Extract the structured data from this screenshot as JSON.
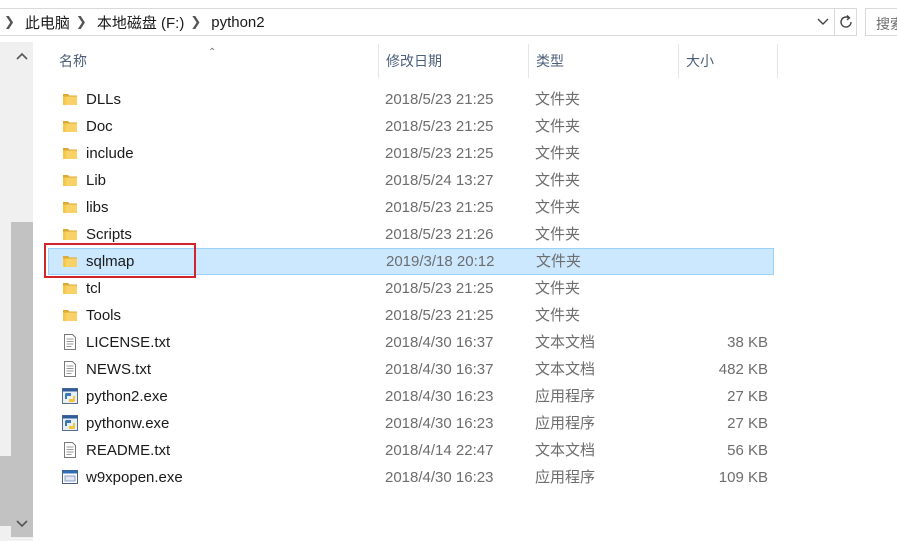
{
  "address": {
    "breadcrumbs": [
      "此电脑",
      "本地磁盘 (F:)",
      "python2"
    ]
  },
  "search": {
    "placeholder": "搜索"
  },
  "columns": {
    "name": "名称",
    "date": "修改日期",
    "type": "类型",
    "size": "大小"
  },
  "files": [
    {
      "name": "DLLs",
      "date": "2018/5/23 21:25",
      "type": "文件夹",
      "size": "",
      "icon": "folder-icon"
    },
    {
      "name": "Doc",
      "date": "2018/5/23 21:25",
      "type": "文件夹",
      "size": "",
      "icon": "folder-icon"
    },
    {
      "name": "include",
      "date": "2018/5/23 21:25",
      "type": "文件夹",
      "size": "",
      "icon": "folder-icon"
    },
    {
      "name": "Lib",
      "date": "2018/5/24 13:27",
      "type": "文件夹",
      "size": "",
      "icon": "folder-icon"
    },
    {
      "name": "libs",
      "date": "2018/5/23 21:25",
      "type": "文件夹",
      "size": "",
      "icon": "folder-icon"
    },
    {
      "name": "Scripts",
      "date": "2018/5/23 21:26",
      "type": "文件夹",
      "size": "",
      "icon": "folder-icon"
    },
    {
      "name": "sqlmap",
      "date": "2019/3/18 20:12",
      "type": "文件夹",
      "size": "",
      "icon": "folder-icon",
      "selected": true
    },
    {
      "name": "tcl",
      "date": "2018/5/23 21:25",
      "type": "文件夹",
      "size": "",
      "icon": "folder-icon"
    },
    {
      "name": "Tools",
      "date": "2018/5/23 21:25",
      "type": "文件夹",
      "size": "",
      "icon": "folder-icon"
    },
    {
      "name": "LICENSE.txt",
      "date": "2018/4/30 16:37",
      "type": "文本文档",
      "size": "38 KB",
      "icon": "text-file-icon"
    },
    {
      "name": "NEWS.txt",
      "date": "2018/4/30 16:37",
      "type": "文本文档",
      "size": "482 KB",
      "icon": "text-file-icon"
    },
    {
      "name": "python2.exe",
      "date": "2018/4/30 16:23",
      "type": "应用程序",
      "size": "27 KB",
      "icon": "python-exe-icon"
    },
    {
      "name": "pythonw.exe",
      "date": "2018/4/30 16:23",
      "type": "应用程序",
      "size": "27 KB",
      "icon": "python-exe-icon"
    },
    {
      "name": "README.txt",
      "date": "2018/4/14 22:47",
      "type": "文本文档",
      "size": "56 KB",
      "icon": "text-file-icon"
    },
    {
      "name": "w9xpopen.exe",
      "date": "2018/4/30 16:23",
      "type": "应用程序",
      "size": "109 KB",
      "icon": "exe-window-icon"
    }
  ],
  "colors": {
    "selection_bg": "#cce8ff",
    "selection_border": "#99d1ff",
    "highlight_box": "#d0252c",
    "folder": "#f5c84a"
  }
}
